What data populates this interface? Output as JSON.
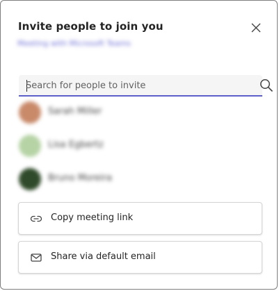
{
  "dialog": {
    "title": "Invite people to join you",
    "subtitle": "Meeting with Microsoft Teams"
  },
  "search": {
    "placeholder": "Search for people to invite"
  },
  "people": [
    {
      "name": "Sarah Miller",
      "avatar_color": "#c98a6a"
    },
    {
      "name": "Lisa Egbertz",
      "avatar_color": "#b6d3a5"
    },
    {
      "name": "Bruno Moreira",
      "avatar_color": "#2f4a2a"
    }
  ],
  "actions": {
    "copy_link": {
      "label": "Copy meeting link",
      "icon": "link-icon"
    },
    "share_email": {
      "label": "Share via default email",
      "icon": "mail-icon"
    }
  },
  "colors": {
    "accent": "#5b5fc7",
    "text": "#242424"
  }
}
